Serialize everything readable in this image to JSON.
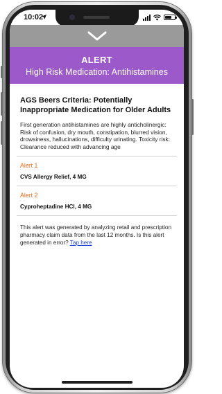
{
  "status_bar": {
    "time": "10:02",
    "location_icon": "location-arrow-icon",
    "signal_icon": "cellular-signal-icon",
    "wifi_icon": "wifi-icon",
    "battery_icon": "battery-icon",
    "battery_level": 0.7
  },
  "dismiss": {
    "icon": "chevron-down-icon"
  },
  "header": {
    "title": "ALERT",
    "subtitle": "High Risk Medication: Antihistamines",
    "background_color": "#9b59c9"
  },
  "criteria": {
    "title": "AGS Beers Criteria: Potentially Inappropriate Medication for Older Adults",
    "description": "First generation antihistamines are highly anticholinergic: Risk of confusion, dry mouth, constipation, blurred vision, drowsiness, hallucinations, difficulty urinating. Toxicity risk: Clearance reduced with advancing age"
  },
  "alerts": [
    {
      "label": "Alert 1",
      "drug": "CVS Allergy Relief, 4 MG"
    },
    {
      "label": "Alert 2",
      "drug": "Cyproheptadine HCl, 4 MG"
    }
  ],
  "footer": {
    "text": "This alert was generated by analyzing retail and prescription pharmacy claim data from the last 12 months. Is this alert generated in error?",
    "link_text": "Tap here"
  },
  "colors": {
    "accent_orange": "#e86a1a",
    "link_blue": "#1a3fd6"
  }
}
